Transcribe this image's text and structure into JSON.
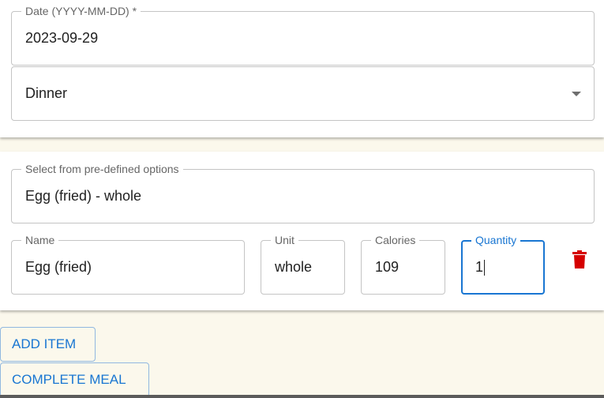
{
  "meal": {
    "date": {
      "label": "Date (YYYY-MM-DD) *",
      "value": "2023-09-29"
    },
    "meal_type": {
      "value": "Dinner",
      "icon": "chevron-down-icon"
    }
  },
  "item": {
    "predefined": {
      "label": "Select from pre-defined options",
      "value": "Egg (fried) - whole"
    },
    "name": {
      "label": "Name",
      "value": "Egg (fried)"
    },
    "unit": {
      "label": "Unit",
      "value": "whole"
    },
    "calories": {
      "label": "Calories",
      "value": "109"
    },
    "quantity": {
      "label": "Quantity",
      "value": "1"
    },
    "delete_icon": "trash-icon",
    "delete_color": "#d50000"
  },
  "actions": {
    "add_item": "ADD ITEM",
    "complete_meal": "COMPLETE MEAL"
  },
  "colors": {
    "accent": "#1976d2",
    "background": "#fbf8ec"
  }
}
